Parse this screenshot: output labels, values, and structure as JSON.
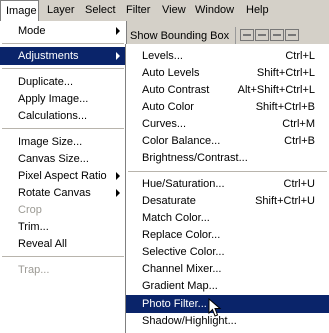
{
  "menubar": [
    {
      "label": "Image",
      "active": true
    },
    {
      "label": "Layer"
    },
    {
      "label": "Select"
    },
    {
      "label": "Filter"
    },
    {
      "label": "View"
    },
    {
      "label": "Window"
    },
    {
      "label": "Help"
    }
  ],
  "options": {
    "show_bounding_box": "Show Bounding Box"
  },
  "image_menu": {
    "mode": "Mode",
    "adjustments": "Adjustments",
    "duplicate": "Duplicate...",
    "apply_image": "Apply Image...",
    "calculations": "Calculations...",
    "image_size": "Image Size...",
    "canvas_size": "Canvas Size...",
    "pixel_aspect": "Pixel Aspect Ratio",
    "rotate_canvas": "Rotate Canvas",
    "crop": "Crop",
    "trim": "Trim...",
    "reveal_all": "Reveal All",
    "trap": "Trap..."
  },
  "adjustments_menu": {
    "levels": {
      "label": "Levels...",
      "sc": "Ctrl+L"
    },
    "auto_levels": {
      "label": "Auto Levels",
      "sc": "Shift+Ctrl+L"
    },
    "auto_contrast": {
      "label": "Auto Contrast",
      "sc": "Alt+Shift+Ctrl+L"
    },
    "auto_color": {
      "label": "Auto Color",
      "sc": "Shift+Ctrl+B"
    },
    "curves": {
      "label": "Curves...",
      "sc": "Ctrl+M"
    },
    "color_balance": {
      "label": "Color Balance...",
      "sc": "Ctrl+B"
    },
    "brightness": {
      "label": "Brightness/Contrast..."
    },
    "hue_sat": {
      "label": "Hue/Saturation...",
      "sc": "Ctrl+U"
    },
    "desaturate": {
      "label": "Desaturate",
      "sc": "Shift+Ctrl+U"
    },
    "match_color": {
      "label": "Match Color..."
    },
    "replace_color": {
      "label": "Replace Color..."
    },
    "selective_color": {
      "label": "Selective Color..."
    },
    "channel_mixer": {
      "label": "Channel Mixer..."
    },
    "gradient_map": {
      "label": "Gradient Map..."
    },
    "photo_filter": {
      "label": "Photo Filter..."
    },
    "shadow_highlight": {
      "label": "Shadow/Highlight..."
    }
  },
  "colors": {
    "highlight": "#0a246a",
    "menu_bg": "#ffffff",
    "chrome": "#d4d0c8",
    "disabled": "#9c9a94"
  }
}
